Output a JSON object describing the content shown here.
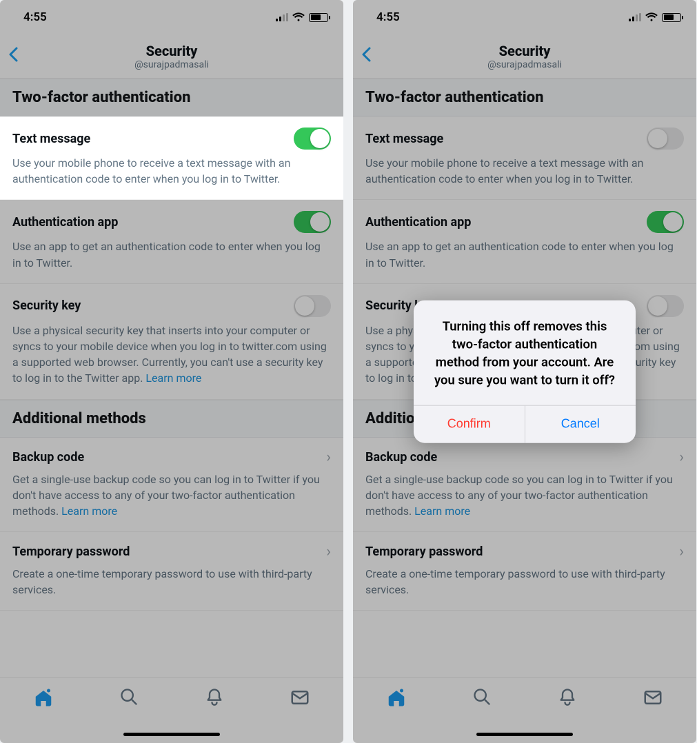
{
  "statusbar": {
    "time": "4:55"
  },
  "nav": {
    "title": "Security",
    "subtitle": "@surajpadmasali"
  },
  "sections": {
    "twofa_header": "Two-factor authentication",
    "additional_header": "Additional methods"
  },
  "rows": {
    "text_message": {
      "title": "Text message",
      "desc": "Use your mobile phone to receive a text message with an authentication code to enter when you log in to Twitter."
    },
    "auth_app": {
      "title": "Authentication app",
      "desc": "Use an app to get an authentication code to enter when you log in to Twitter."
    },
    "security_key": {
      "title": "Security key",
      "desc_pre": "Use a physical security key that inserts into your computer or syncs to your mobile device when you log in to  twitter.com using a supported web browser. Currently, you can't use a security key to log in to the Twitter app. ",
      "learn_more": "Learn more"
    },
    "backup_code": {
      "title": "Backup code",
      "desc_pre": "Get a single-use backup code so you can log in to Twitter if you don't have access to any of your two-factor authentication methods. ",
      "learn_more": "Learn more"
    },
    "temp_password": {
      "title": "Temporary password",
      "desc": "Create a one-time temporary password to use with third-party services."
    }
  },
  "toggles": {
    "left": {
      "text_message": true,
      "auth_app": true,
      "security_key": false
    },
    "right": {
      "text_message": false,
      "auth_app": true,
      "security_key": false
    }
  },
  "dialog": {
    "message": "Turning this off removes this two-factor authentication method from your account. Are you sure you want to turn it off?",
    "confirm": "Confirm",
    "cancel": "Cancel"
  },
  "colors": {
    "accent": "#1d9bf0",
    "toggle_on": "#34c759",
    "destructive": "#ff3b30",
    "ios_blue": "#007aff"
  }
}
